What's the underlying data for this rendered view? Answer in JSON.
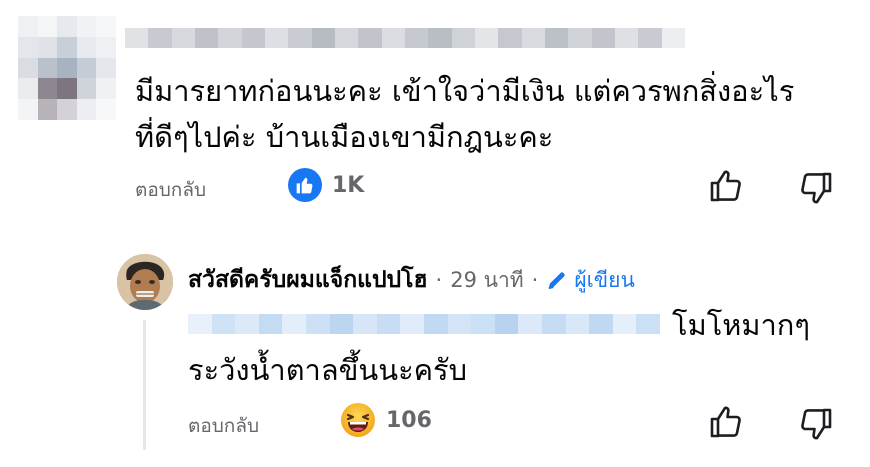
{
  "comment": {
    "text_line1": "มีมารยาทก่อนนะคะ เข้าใจว่ามีเงิน แต่ควรพกสิ่งอะไร",
    "text_line2": "ที่ดีๆไปค่ะ บ้านเมืองเขามีกฎนะคะ",
    "reply_label": "ตอบกลับ",
    "reaction_icon": "like-icon",
    "reaction_count": "1K"
  },
  "reply": {
    "author_name": "สวัสดีครับผมแจ็กแปปโฮ",
    "separator": "·",
    "time": "29 นาที",
    "separator2": "·",
    "author_badge": "ผู้เขียน",
    "text_line1_suffix": "โมโหมากๆ",
    "text_line2": "ระวังน้ำตาลขึ้นนะครับ",
    "reply_label": "ตอบกลับ",
    "reaction_icon": "laughing-face-icon",
    "reaction_count": "106"
  },
  "colors": {
    "accent": "#1877f2",
    "muted_text": "#65676b",
    "reaction_emoji": "#f7b125"
  }
}
